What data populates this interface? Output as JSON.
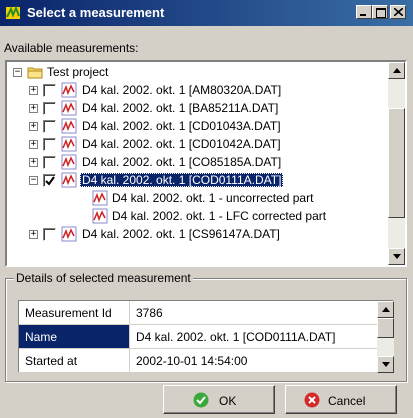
{
  "window": {
    "title": "Select a measurement"
  },
  "available_label": "Available measurements:",
  "tree": {
    "root_label": "Test project",
    "items": [
      {
        "label": "D4 kal. 2002. okt. 1 [AM80320A.DAT]",
        "checked": false,
        "expanded": false
      },
      {
        "label": "D4 kal. 2002. okt. 1 [BA85211A.DAT]",
        "checked": false,
        "expanded": false
      },
      {
        "label": "D4 kal. 2002. okt. 1 [CD01043A.DAT]",
        "checked": false,
        "expanded": false
      },
      {
        "label": "D4 kal. 2002. okt. 1 [CD01042A.DAT]",
        "checked": false,
        "expanded": false
      },
      {
        "label": "D4 kal. 2002. okt. 1 [CO85185A.DAT]",
        "checked": false,
        "expanded": false
      },
      {
        "label": "D4 kal. 2002. okt. 1 [COD0111A.DAT]",
        "checked": true,
        "expanded": true,
        "selected": true
      },
      {
        "label": "D4 kal. 2002. okt. 1 - uncorrected part",
        "child": true
      },
      {
        "label": "D4 kal. 2002. okt. 1 - LFC corrected part",
        "child": true
      },
      {
        "label": "D4 kal. 2002. okt. 1 [CS96147A.DAT]",
        "checked": false,
        "expanded": false
      }
    ]
  },
  "details": {
    "group_title": "Details of selected measurement",
    "rows": [
      {
        "label": "Measurement Id",
        "value": "3786"
      },
      {
        "label": "Name",
        "value": "D4 kal. 2002. okt. 1 [COD0111A.DAT]",
        "selected": true
      },
      {
        "label": "Started at",
        "value": "2002-10-01 14:54:00"
      }
    ]
  },
  "buttons": {
    "ok_label": "OK",
    "cancel_label": "Cancel"
  },
  "colors": {
    "title_bar": "#0a246a",
    "selection": "#0a246a",
    "face": "#d4d0c8"
  }
}
